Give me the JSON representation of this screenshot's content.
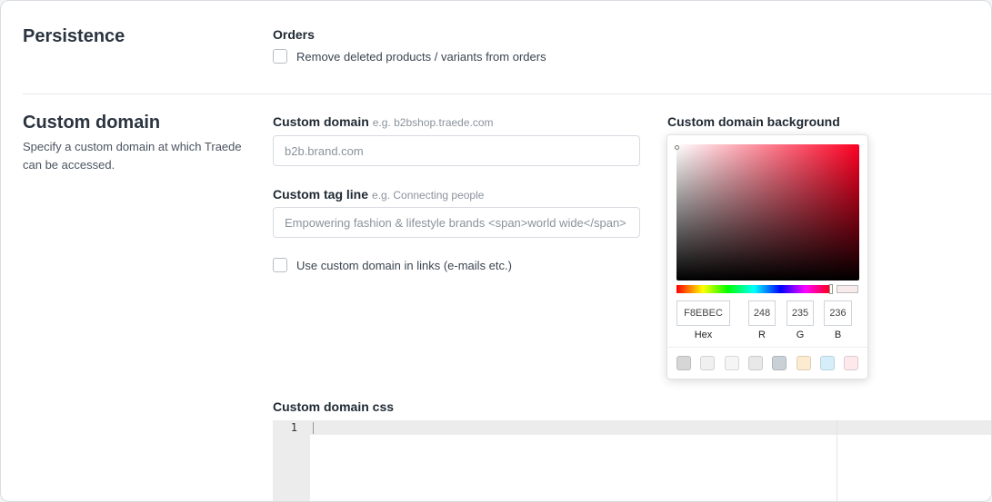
{
  "persistence": {
    "title": "Persistence",
    "orders_label": "Orders",
    "remove_deleted_label": "Remove deleted products / variants from orders"
  },
  "custom_domain": {
    "title": "Custom domain",
    "description": "Specify a custom domain at which Traede can be accessed.",
    "domain_label": "Custom domain",
    "domain_hint": "e.g. b2bshop.traede.com",
    "domain_placeholder": "b2b.brand.com",
    "tagline_label": "Custom tag line",
    "tagline_hint": "e.g. Connecting people",
    "tagline_placeholder": "Empowering fashion & lifestyle brands <span>world wide</span>",
    "use_in_links_label": "Use custom domain in links (e-mails etc.)",
    "background_label": "Custom domain background",
    "css_label": "Custom domain css"
  },
  "color_picker": {
    "hex": "F8EBEC",
    "r": "248",
    "g": "235",
    "b": "236",
    "hex_label": "Hex",
    "r_label": "R",
    "g_label": "G",
    "b_label": "B",
    "current_color": "#f8ebec",
    "swatches": [
      "#d6d6d6",
      "#f0f0f0",
      "#f5f5f5",
      "#e8e8e8",
      "#c9d1d6",
      "#fdebd0",
      "#d6eefa",
      "#fde8ec"
    ]
  },
  "editor": {
    "line_number": "1"
  }
}
